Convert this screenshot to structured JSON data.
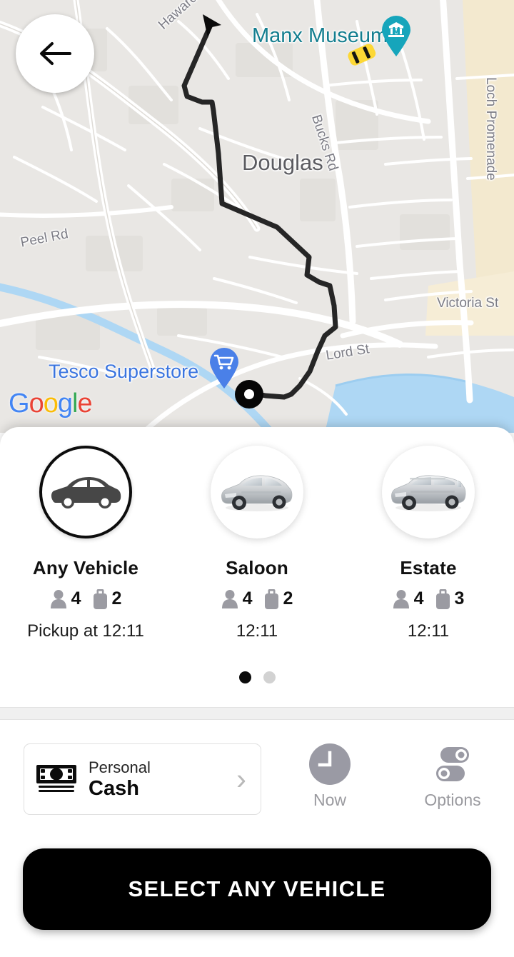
{
  "header": {
    "back_icon": "back-arrow-icon"
  },
  "map": {
    "attribution": "Google",
    "attribution_letters": [
      "G",
      "o",
      "o",
      "g",
      "l",
      "e"
    ],
    "labels": [
      {
        "text": "Manx Museum",
        "type": "poi-teal"
      },
      {
        "text": "Douglas",
        "type": "city"
      },
      {
        "text": "Hawarden Ave",
        "type": "street"
      },
      {
        "text": "Bucks Rd",
        "type": "street"
      },
      {
        "text": "Loch Promenade",
        "type": "street"
      },
      {
        "text": "Peel Rd",
        "type": "street"
      },
      {
        "text": "Victoria St",
        "type": "street"
      },
      {
        "text": "Lord St",
        "type": "street"
      },
      {
        "text": "Tesco Superstore",
        "type": "poi-blue"
      }
    ],
    "markers": [
      {
        "name": "museum-pin",
        "color": "#17a2b8"
      },
      {
        "name": "taxi-car-marker",
        "color": "#fdd835"
      },
      {
        "name": "shopping-cart-pin",
        "color": "#4285F4"
      },
      {
        "name": "pickup-location-marker",
        "color": "#000000"
      },
      {
        "name": "navigation-cursor-marker",
        "color": "#000000"
      }
    ],
    "route_color": "#1f1f1f"
  },
  "vehicles": {
    "items": [
      {
        "name": "Any Vehicle",
        "passengers": "4",
        "luggage": "2",
        "time_prefix": "Pickup at ",
        "time": "12:11",
        "selected": true,
        "icon": "sedan-silhouette-icon"
      },
      {
        "name": "Saloon",
        "passengers": "4",
        "luggage": "2",
        "time_prefix": "",
        "time": "12:11",
        "selected": false,
        "icon": "saloon-car-photo"
      },
      {
        "name": "Estate",
        "passengers": "4",
        "luggage": "3",
        "time_prefix": "",
        "time": "12:11",
        "selected": false,
        "icon": "estate-car-photo"
      }
    ],
    "pagination": {
      "total": 2,
      "active_index": 0
    }
  },
  "payment": {
    "account_type": "Personal",
    "method": "Cash",
    "icon": "cash-banknote-icon",
    "chevron": "›"
  },
  "quick_actions": [
    {
      "label": "Now",
      "icon": "clock-icon"
    },
    {
      "label": "Options",
      "icon": "toggles-icon"
    }
  ],
  "cta": {
    "label": "SELECT ANY VEHICLE"
  },
  "colors": {
    "accent_teal": "#137e8f",
    "accent_blue": "#3a74df",
    "cta_background": "#000000",
    "panel_background": "#ffffff",
    "map_background": "#e9e7e4"
  }
}
